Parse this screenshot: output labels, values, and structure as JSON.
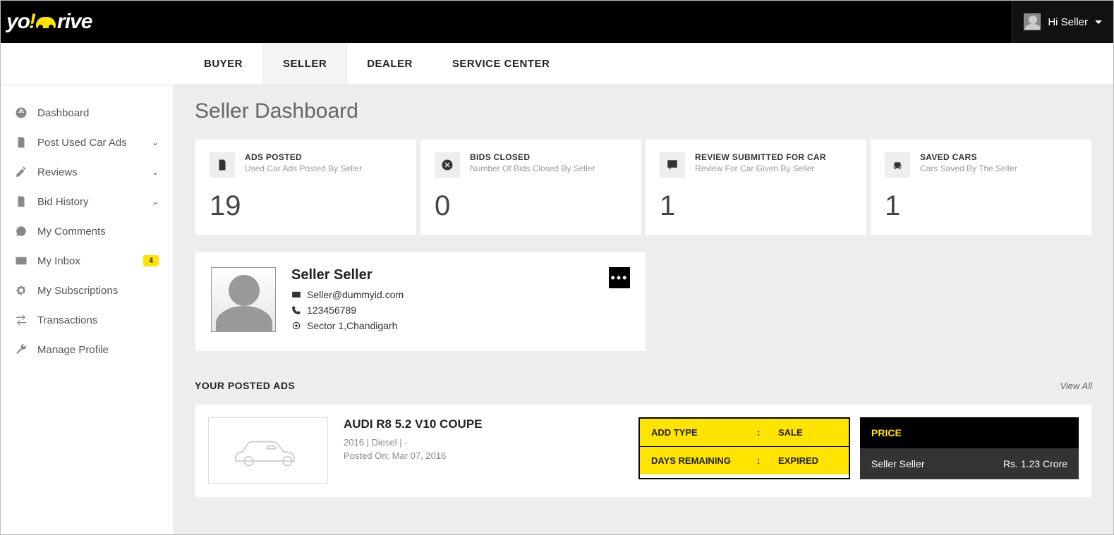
{
  "header": {
    "logo_pre": "yo",
    "logo_ex": "!",
    "logo_post": "rive",
    "user_greeting": "Hi Seller"
  },
  "topnav": {
    "tabs": [
      "BUYER",
      "SELLER",
      "DEALER",
      "SERVICE CENTER"
    ],
    "active": 1
  },
  "sidebar": {
    "items": [
      {
        "label": "Dashboard",
        "icon": "dashboard"
      },
      {
        "label": "Post Used Car Ads",
        "icon": "doc",
        "expand": true
      },
      {
        "label": "Reviews",
        "icon": "pencil",
        "expand": true
      },
      {
        "label": "Bid History",
        "icon": "doc",
        "expand": true
      },
      {
        "label": "My Comments",
        "icon": "comment"
      },
      {
        "label": "My Inbox",
        "icon": "mail",
        "badge": "4"
      },
      {
        "label": "My Subscriptions",
        "icon": "gear"
      },
      {
        "label": "Transactions",
        "icon": "trans"
      },
      {
        "label": "Manage Profile",
        "icon": "wrench"
      }
    ]
  },
  "page": {
    "title": "Seller Dashboard"
  },
  "stats": [
    {
      "icon": "doc",
      "title": "ADS POSTED",
      "sub": "Used Car Ads Posted By Seller",
      "value": "19"
    },
    {
      "icon": "close",
      "title": "BIDS CLOSED",
      "sub": "Number Of Bids Closed By Seller",
      "value": "0"
    },
    {
      "icon": "review",
      "title": "REVIEW SUBMITTED FOR CAR",
      "sub": "Review For Car Given By Seller",
      "value": "1"
    },
    {
      "icon": "car",
      "title": "SAVED CARS",
      "sub": "Cars Saved By The Seller",
      "value": "1"
    }
  ],
  "profile": {
    "name": "Seller Seller",
    "email": "Seller@dummyid.com",
    "phone": "123456789",
    "location": "Sector 1,Chandigarh"
  },
  "ads_section": {
    "title": "YOUR POSTED ADS",
    "view_all": "View All"
  },
  "ad": {
    "title": "AUDI R8 5.2 V10 COUPE",
    "meta": "2016 | Diesel | -",
    "posted_label": "Posted On: ",
    "posted_date": "Mar 07, 2016",
    "add_type_label": "ADD TYPE",
    "add_type_value": "SALE",
    "days_label": "DAYS REMAINING",
    "days_value": "EXPIRED",
    "price_header": "PRICE",
    "price_seller": "Seller Seller",
    "price_value": "Rs. 1.23 Crore"
  }
}
